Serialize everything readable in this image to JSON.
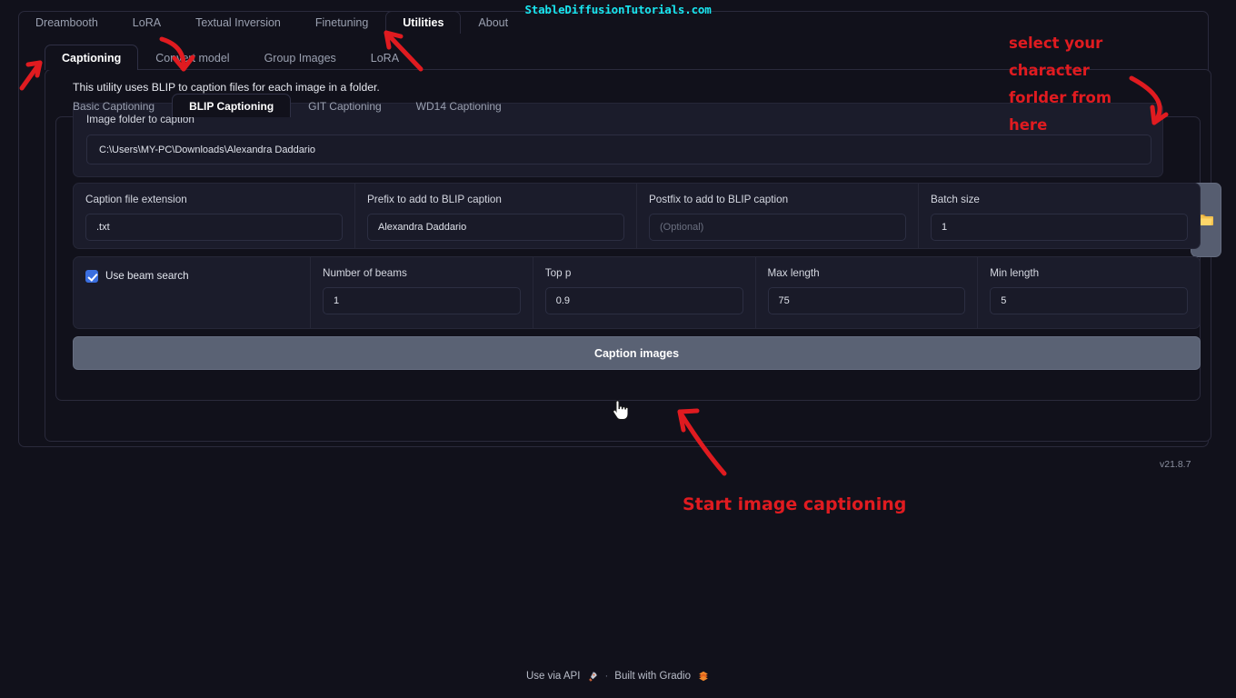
{
  "watermark": "StableDiffusionTutorials.com",
  "top_tabs": [
    {
      "label": "Dreambooth",
      "active": false
    },
    {
      "label": "LoRA",
      "active": false
    },
    {
      "label": "Textual Inversion",
      "active": false
    },
    {
      "label": "Finetuning",
      "active": false
    },
    {
      "label": "Utilities",
      "active": true
    },
    {
      "label": "About",
      "active": false
    }
  ],
  "tabs_level2": [
    {
      "label": "Captioning",
      "active": true
    },
    {
      "label": "Convert model",
      "active": false
    },
    {
      "label": "Group Images",
      "active": false
    },
    {
      "label": "LoRA",
      "active": false
    }
  ],
  "tabs_level3": [
    {
      "label": "Basic Captioning",
      "active": false
    },
    {
      "label": "BLIP Captioning",
      "active": true
    },
    {
      "label": "GIT Captioning",
      "active": false
    },
    {
      "label": "WD14 Captioning",
      "active": false
    }
  ],
  "description": "This utility uses BLIP to caption files for each image in a folder.",
  "folder_group": {
    "label": "Image folder to caption",
    "value": "C:\\Users\\MY-PC\\Downloads\\Alexandra Daddario",
    "browse_icon": "folder-icon"
  },
  "row2_fields": [
    {
      "label": "Caption file extension",
      "value": ".txt",
      "placeholder": ""
    },
    {
      "label": "Prefix to add to BLIP caption",
      "value": "Alexandra Daddario",
      "placeholder": ""
    },
    {
      "label": "Postfix to add to BLIP caption",
      "value": "",
      "placeholder": "(Optional)"
    },
    {
      "label": "Batch size",
      "value": "1",
      "placeholder": ""
    }
  ],
  "beam_search": {
    "checkbox_label": "Use beam search",
    "checked": true
  },
  "row3_fields": [
    {
      "label": "Number of beams",
      "value": "1"
    },
    {
      "label": "Top p",
      "value": "0.9"
    },
    {
      "label": "Max length",
      "value": "75"
    },
    {
      "label": "Min length",
      "value": "5"
    }
  ],
  "caption_button": "Caption images",
  "version": "v21.8.7",
  "footer": {
    "api_label": "Use via API",
    "api_icon": "rocket-icon",
    "separator": "·",
    "gradio_label": "Built with Gradio",
    "gradio_icon": "gradio-logo-icon"
  },
  "annotations": {
    "select_folder": "select your character forlder from here",
    "start_caption": "Start image captioning"
  },
  "colors": {
    "accent_red": "#e01b20",
    "watermark_cyan": "#19e5ef",
    "checkbox_blue": "#3b6fe0",
    "folder_yellow": "#f2c14e",
    "page_bg": "#11111b",
    "group_bg": "#1b1c2b",
    "button_gray": "#5a6274"
  }
}
